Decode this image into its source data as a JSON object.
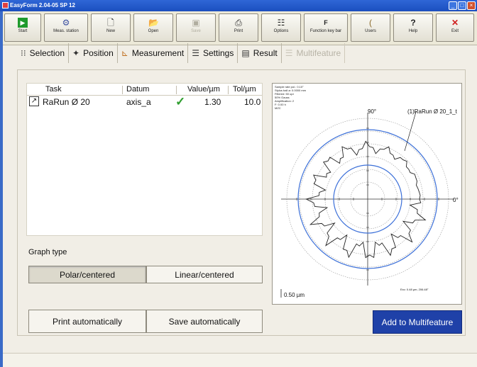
{
  "window": {
    "title": "EasyForm 2.04-05 SP 12"
  },
  "toolbar": {
    "buttons": [
      {
        "label": "Start",
        "icon": "play-icon",
        "color": "#1f9a2c"
      },
      {
        "label": "Meas. station",
        "icon": "station-icon"
      },
      {
        "label": "New",
        "icon": "new-document-icon"
      },
      {
        "label": "Open",
        "icon": "open-folder-icon"
      },
      {
        "label": "Save",
        "icon": "save-icon",
        "disabled": true
      },
      {
        "label": "Print",
        "icon": "printer-icon"
      },
      {
        "label": "Options",
        "icon": "options-icon"
      },
      {
        "label": "Function key bar",
        "icon": "function-key-icon"
      },
      {
        "label": "Users",
        "icon": "users-icon"
      },
      {
        "label": "Help",
        "icon": "help-icon"
      },
      {
        "label": "Exit",
        "icon": "exit-icon",
        "color": "#d02020"
      }
    ]
  },
  "tabs": [
    {
      "label": "Selection",
      "icon": "selection-icon"
    },
    {
      "label": "Position",
      "icon": "position-icon"
    },
    {
      "label": "Measurement",
      "icon": "measurement-icon"
    },
    {
      "label": "Settings",
      "icon": "settings-icon"
    },
    {
      "label": "Result",
      "icon": "result-icon",
      "active": true
    },
    {
      "label": "Multifeature",
      "icon": "multifeature-icon",
      "disabled": true
    }
  ],
  "table": {
    "headers": [
      "Task",
      "Datum",
      "Value/µm",
      "Tol/µm"
    ],
    "rows": [
      {
        "task": "RaRun Ø 20",
        "datum": "axis_a",
        "status": "ok",
        "value": "1.30",
        "tol": "10.0"
      }
    ]
  },
  "graph_type": {
    "label": "Graph type",
    "options": [
      "Polar/centered",
      "Linear/centered"
    ],
    "selected": "Polar/centered"
  },
  "buttons": {
    "print_auto": "Print automatically",
    "save_auto": "Save automatically",
    "add_multifeature": "Add to Multifeature"
  },
  "graph": {
    "info_lines": [
      "Sample rate pol.: 0.10°",
      "Stylus ball ø: 0.0000 mm",
      "Filtered: 50 upr",
      "50% Gauss",
      "Amplification: 2",
      "F: 0.00 h",
      "MZC"
    ],
    "angle_90": "90°",
    "angle_0": "0°",
    "curve_label": "(1)RaRun Ø 20_1_t",
    "scale_label": "0.50 µm",
    "exc_label": "Exc: 0.48 µm, 206.48°"
  },
  "colors": {
    "accent_button": "#1f41a8",
    "reference_circle": "#3b6fd8",
    "ok_check": "#2f9e2f"
  }
}
